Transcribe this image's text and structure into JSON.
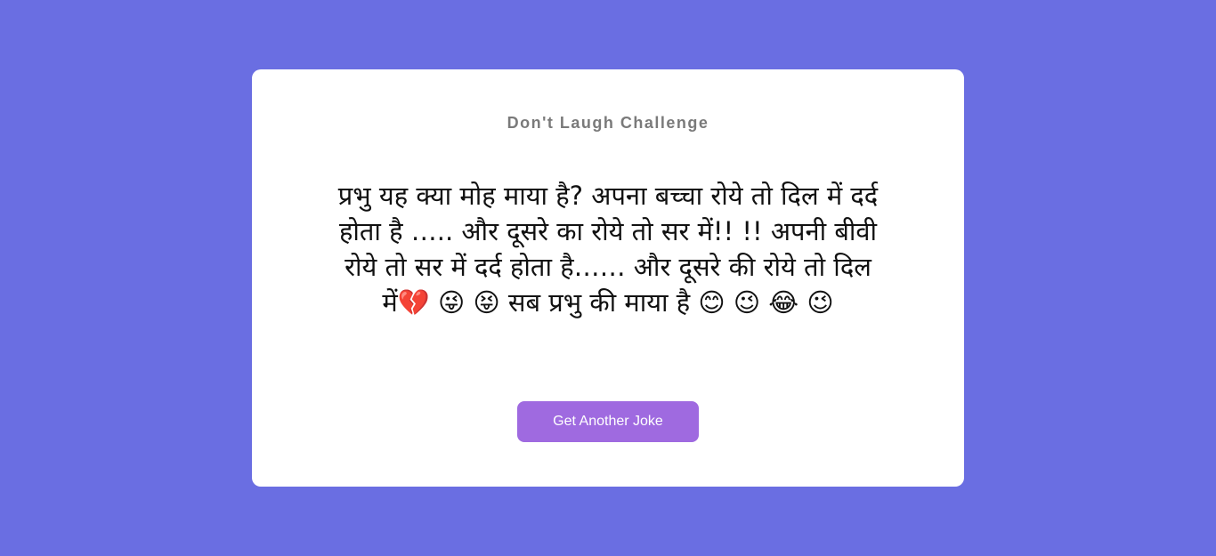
{
  "page": {
    "background_color": "#6a6ee2"
  },
  "card": {
    "title": "Don't Laugh Challenge",
    "joke_text": "प्रभु यह क्या मोह माया है? अपना बच्चा रोये तो दिल में दर्द होता है ….. और दूसरे का रोये तो सर में!! !! अपनी बीवी रोये तो सर में दर्द होता है…… और दूसरे की रोये तो दिल में💔 😜 😝 सब प्रभु की माया है 😊 😉 😂 😉",
    "button_label": "Get Another Joke",
    "button_color": "#9f6ae0"
  }
}
